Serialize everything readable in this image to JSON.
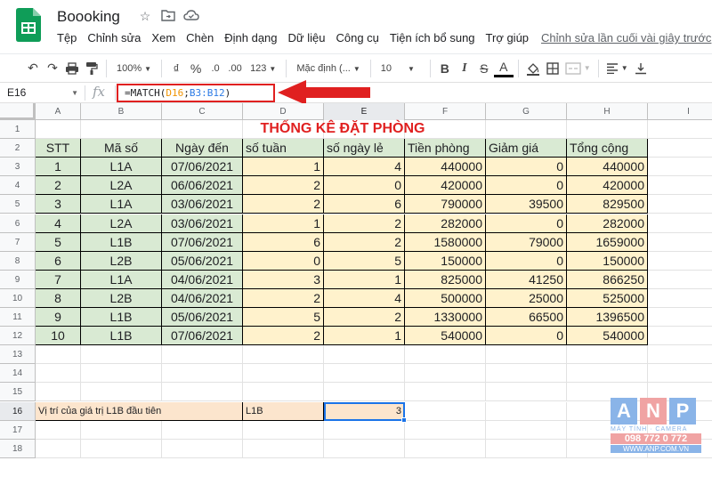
{
  "app": {
    "doc_title": "Boooking",
    "menu": [
      "Tệp",
      "Chỉnh sửa",
      "Xem",
      "Chèn",
      "Định dạng",
      "Dữ liệu",
      "Công cụ",
      "Tiện ích bổ sung",
      "Trợ giúp"
    ],
    "last_edit": "Chỉnh sửa lần cuối vài giây trước"
  },
  "toolbar": {
    "zoom": "100%",
    "currency": "₫",
    "percent": "%",
    "dec_less": ".0",
    "dec_more": ".00",
    "format_num": "123",
    "font": "Mặc định (...",
    "font_size": "10",
    "bold": "B",
    "italic": "I",
    "strike": "S",
    "text_color": "A"
  },
  "formula_bar": {
    "cell_ref": "E16",
    "fx": "fx",
    "formula_prefix": "=MATCH(",
    "formula_ref1": "D16",
    "formula_sep": ";",
    "formula_ref2": "B3:B12",
    "formula_suffix": ")"
  },
  "columns": [
    "A",
    "B",
    "C",
    "D",
    "E",
    "F",
    "G",
    "H",
    "I"
  ],
  "rows": [
    "1",
    "2",
    "3",
    "4",
    "5",
    "6",
    "7",
    "8",
    "9",
    "10",
    "11",
    "12",
    "13",
    "14",
    "15",
    "16",
    "17",
    "18"
  ],
  "table": {
    "title": "THỐNG KÊ ĐẶT PHÒNG",
    "headers": [
      "STT",
      "Mã số",
      "Ngày đến",
      "số tuần",
      "số ngày lẻ",
      "Tiền phòng",
      "Giảm giá",
      "Tổng cộng"
    ],
    "data": [
      [
        "1",
        "L1A",
        "07/06/2021",
        "1",
        "4",
        "440000",
        "0",
        "440000"
      ],
      [
        "2",
        "L2A",
        "06/06/2021",
        "2",
        "0",
        "420000",
        "0",
        "420000"
      ],
      [
        "3",
        "L1A",
        "03/06/2021",
        "2",
        "6",
        "790000",
        "39500",
        "829500"
      ],
      [
        "4",
        "L2A",
        "03/06/2021",
        "1",
        "2",
        "282000",
        "0",
        "282000"
      ],
      [
        "5",
        "L1B",
        "07/06/2021",
        "6",
        "2",
        "1580000",
        "79000",
        "1659000"
      ],
      [
        "6",
        "L2B",
        "05/06/2021",
        "0",
        "5",
        "150000",
        "0",
        "150000"
      ],
      [
        "7",
        "L1A",
        "04/06/2021",
        "3",
        "1",
        "825000",
        "41250",
        "866250"
      ],
      [
        "8",
        "L2B",
        "04/06/2021",
        "2",
        "4",
        "500000",
        "25000",
        "525000"
      ],
      [
        "9",
        "L1B",
        "05/06/2021",
        "5",
        "2",
        "1330000",
        "66500",
        "1396500"
      ],
      [
        "10",
        "L1B",
        "07/06/2021",
        "2",
        "1",
        "540000",
        "0",
        "540000"
      ]
    ]
  },
  "lookup": {
    "label": "Vị trí của giá trị L1B đầu tiên",
    "value": "L1B",
    "result": "3"
  },
  "watermark": {
    "letters": [
      "A",
      "N",
      "P"
    ],
    "sub": "MÁY TÍNH · CAMERA",
    "phone": "098 772 0 772",
    "url": "WWW.ANP.COM.VN"
  },
  "colors": {
    "header_green": "#d9ead3",
    "data_yellow": "#fff2cc",
    "lookup_peach": "#fce5cd",
    "title_red": "#e02020",
    "selection_blue": "#1a73e8"
  }
}
